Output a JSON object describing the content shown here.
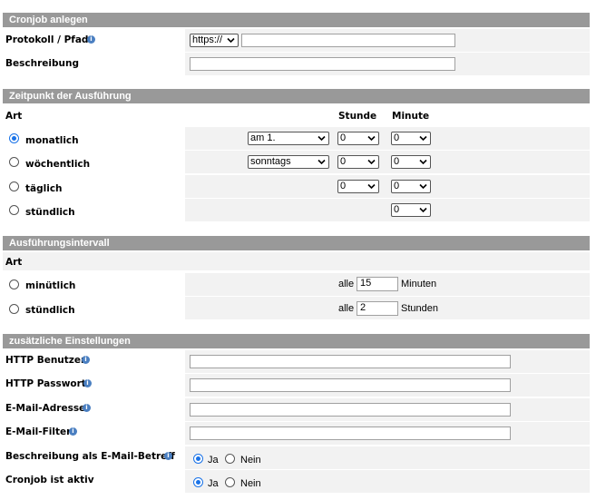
{
  "cronjob": {
    "title": "Cronjob anlegen",
    "protocol_label": "Protokoll / Pfad",
    "protocol_value": "https://",
    "path_value": "",
    "description_label": "Beschreibung",
    "description_value": ""
  },
  "schedule": {
    "title": "Zeitpunkt der Ausführung",
    "col_type": "Art",
    "col_hour": "Stunde",
    "col_minute": "Minute",
    "rows": [
      {
        "label": "monatlich",
        "selected": true,
        "day": "am 1.",
        "hour": "0",
        "minute": "0"
      },
      {
        "label": "wöchentlich",
        "selected": false,
        "day": "sonntags",
        "hour": "0",
        "minute": "0"
      },
      {
        "label": "täglich",
        "selected": false,
        "hour": "0",
        "minute": "0"
      },
      {
        "label": "stündlich",
        "selected": false,
        "minute": "0"
      }
    ]
  },
  "interval": {
    "title": "Ausführungsintervall",
    "col_type": "Art",
    "rows": [
      {
        "label": "minütlich",
        "prefix": "alle",
        "value": "15",
        "unit": "Minuten"
      },
      {
        "label": "stündlich",
        "prefix": "alle",
        "value": "2",
        "unit": "Stunden"
      }
    ]
  },
  "extra": {
    "title": "zusätzliche Einstellungen",
    "http_user_label": "HTTP Benutzer",
    "http_password_label": "HTTP Passwort",
    "email_label": "E-Mail-Adresse",
    "email_filter_label": "E-Mail-Filter",
    "desc_subject_label": "Beschreibung als E-Mail-Betreff",
    "active_label": "Cronjob ist aktiv",
    "yes": "Ja",
    "no": "Nein"
  }
}
